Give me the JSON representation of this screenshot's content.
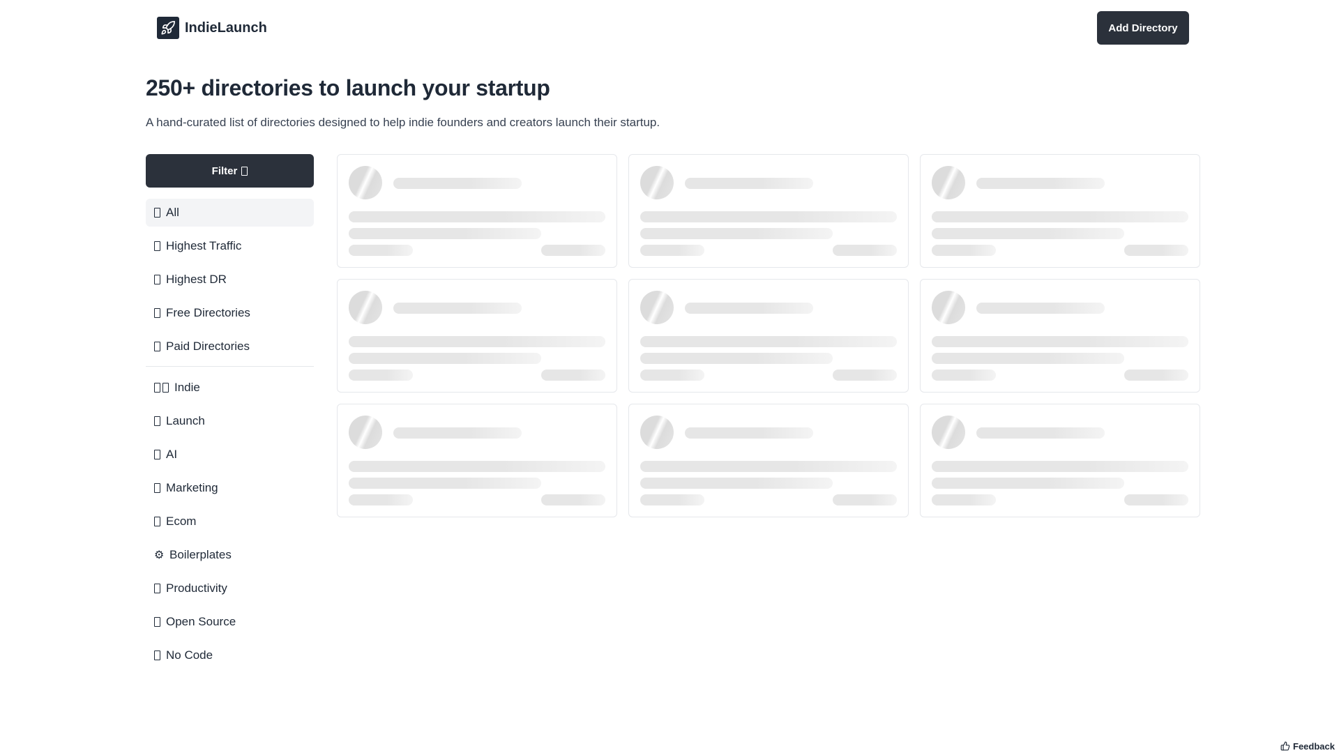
{
  "header": {
    "brand_name": "IndieLaunch",
    "logo_icon": "rocket-icon",
    "add_button_label": "Add Directory"
  },
  "hero": {
    "title": "250+ directories to launch your startup",
    "subtitle": "A hand-curated list of directories designed to help indie founders and creators launch their startup."
  },
  "sidebar": {
    "filter_label": "Filter",
    "primary_items": [
      {
        "label": "All",
        "active": true
      },
      {
        "label": "Highest Traffic"
      },
      {
        "label": "Highest DR"
      },
      {
        "label": "Free Directories"
      },
      {
        "label": "Paid Directories"
      }
    ],
    "category_items": [
      {
        "label": "Indie"
      },
      {
        "label": "Launch"
      },
      {
        "label": "AI"
      },
      {
        "label": "Marketing"
      },
      {
        "label": "Ecom"
      },
      {
        "label": "Boilerplates",
        "icon": "gear-icon"
      },
      {
        "label": "Productivity"
      },
      {
        "label": "Open Source"
      },
      {
        "label": "No Code"
      }
    ]
  },
  "grid": {
    "state": "loading",
    "placeholder_count": 9
  },
  "feedback": {
    "label": "Feedback",
    "icon": "thumbs-up-icon"
  },
  "colors": {
    "dark": "#2b313b",
    "text": "#1f2937",
    "active_bg": "#f3f4f6",
    "border": "#e5e7eb",
    "skeleton": "#e6e6e6"
  }
}
